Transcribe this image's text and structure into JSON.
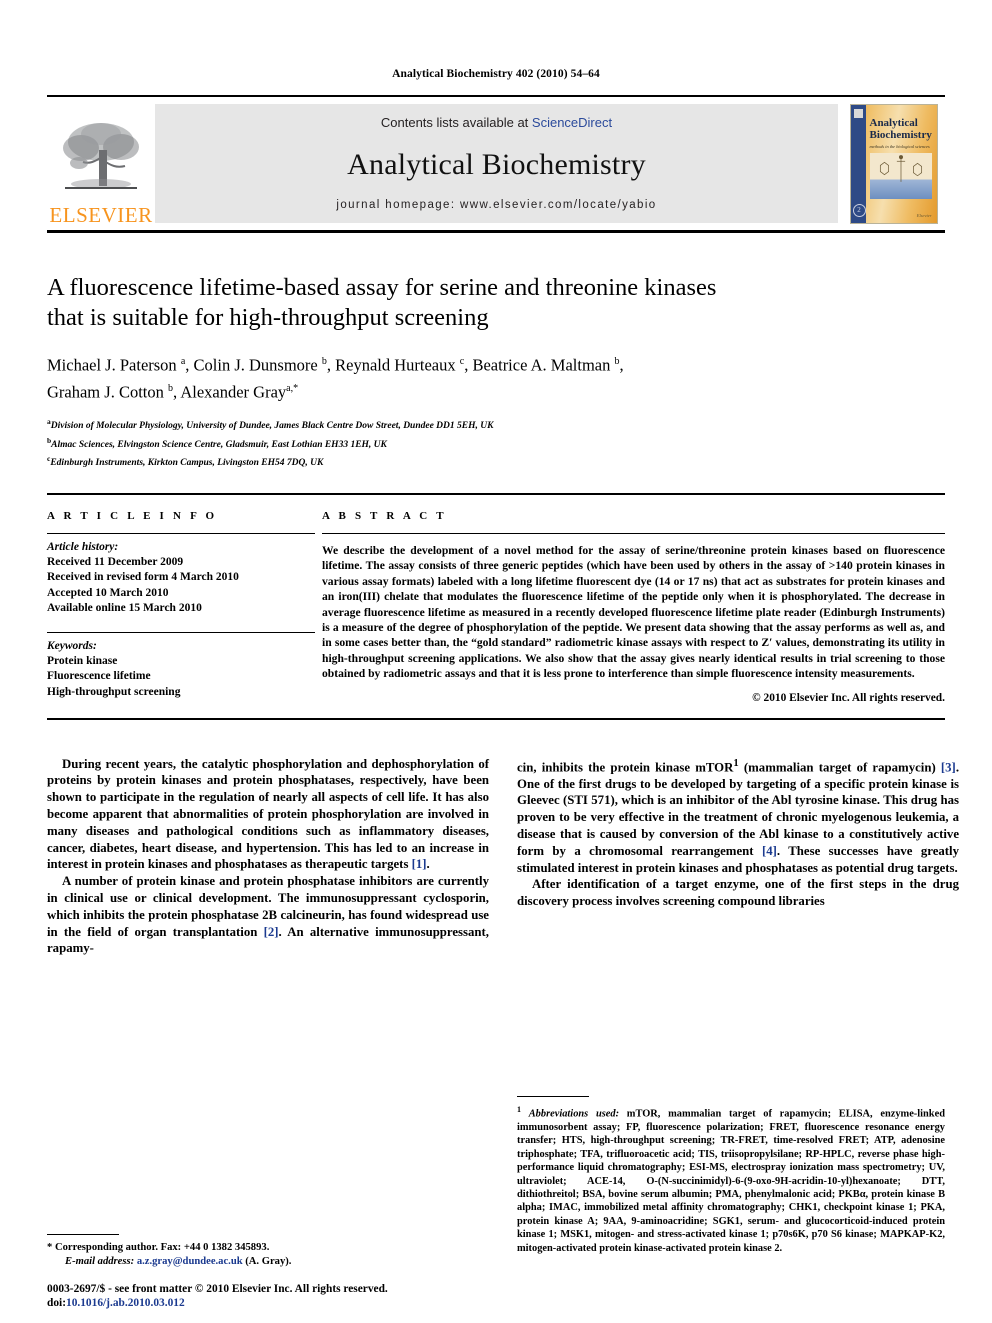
{
  "running_head": "Analytical Biochemistry 402 (2010) 54–64",
  "masthead": {
    "contents_prefix": "Contents lists available at ",
    "sciencedirect": "ScienceDirect",
    "journal_title": "Analytical Biochemistry",
    "homepage": "journal homepage: www.elsevier.com/locate/yabio",
    "publisher_wordmark": "ELSEVIER",
    "cover": {
      "title_line1": "Analytical",
      "title_line2": "Biochemistry",
      "subtitle": "methods in the biological sciences",
      "imprint": "Elsevier",
      "circle_glyph": "2",
      "colors": {
        "spine": "#2e4a86",
        "paper": "#f0c069",
        "accent": "#e49a2c"
      }
    },
    "colors": {
      "band_background": "#e6e6e6",
      "sciencedirect_link": "#2b4a9b",
      "elsevier_orange": "#F7941E"
    }
  },
  "article": {
    "title_line1": "A fluorescence lifetime-based assay for serine and threonine kinases",
    "title_line2": "that is suitable for high-throughput screening",
    "authors_line1": "Michael J. Paterson a, Colin J. Dunsmore b, Reynald Hurteaux c, Beatrice A. Maltman b,",
    "authors_line2": "Graham J. Cotton b, Alexander Gray a,*",
    "authors": [
      {
        "name": "Michael J. Paterson",
        "marks": "a"
      },
      {
        "name": "Colin J. Dunsmore",
        "marks": "b"
      },
      {
        "name": "Reynald Hurteaux",
        "marks": "c"
      },
      {
        "name": "Beatrice A. Maltman",
        "marks": "b"
      },
      {
        "name": "Graham J. Cotton",
        "marks": "b"
      },
      {
        "name": "Alexander Gray",
        "marks": "a,*"
      }
    ],
    "affiliations": [
      {
        "mark": "a",
        "text": "Division of Molecular Physiology, University of Dundee, James Black Centre Dow Street, Dundee DD1 5EH, UK"
      },
      {
        "mark": "b",
        "text": "Almac Sciences, Elvingston Science Centre, Gladsmuir, East Lothian EH33 1EH, UK"
      },
      {
        "mark": "c",
        "text": "Edinburgh Instruments, Kirkton Campus, Livingston EH54 7DQ, UK"
      }
    ]
  },
  "article_info": {
    "heading": "A R T I C L E  I N F O",
    "history_label": "Article history:",
    "history": [
      "Received 11 December 2009",
      "Received in revised form 4 March 2010",
      "Accepted 10 March 2010",
      "Available online 15 March 2010"
    ],
    "keywords_label": "Keywords:",
    "keywords": [
      "Protein kinase",
      "Fluorescence lifetime",
      "High-throughput screening"
    ]
  },
  "abstract": {
    "heading": "A B S T R A C T",
    "text": "We describe the development of a novel method for the assay of serine/threonine protein kinases based on fluorescence lifetime. The assay consists of three generic peptides (which have been used by others in the assay of >140 protein kinases in various assay formats) labeled with a long lifetime fluorescent dye (14 or 17 ns) that act as substrates for protein kinases and an iron(III) chelate that modulates the fluorescence lifetime of the peptide only when it is phosphorylated. The decrease in average fluorescence lifetime as measured in a recently developed fluorescence lifetime plate reader (Edinburgh Instruments) is a measure of the degree of phosphorylation of the peptide. We present data showing that the assay performs as well as, and in some cases better than, the “gold standard” radiometric kinase assays with respect to Z′ values, demonstrating its utility in high-throughput screening applications. We also show that the assay gives nearly identical results in trial screening to those obtained by radiometric assays and that it is less prone to interference than simple fluorescence intensity measurements.",
    "copyright": "© 2010 Elsevier Inc. All rights reserved."
  },
  "body": {
    "left_col": [
      "During recent years, the catalytic phosphorylation and dephosphorylation of proteins by protein kinases and protein phosphatases, respectively, have been shown to participate in the regulation of nearly all aspects of cell life. It has also become apparent that abnormalities of protein phosphorylation are involved in many diseases and pathological conditions such as inflammatory diseases, cancer, diabetes, heart disease, and hypertension. This has led to an increase in interest in protein kinases and phosphatases as therapeutic targets [1].",
      "A number of protein kinase and protein phosphatase inhibitors are currently in clinical use or clinical development. The immunosuppressant cyclosporin, which inhibits the protein phosphatase 2B calcineurin, has found widespread use in the field of organ transplantation [2]. An alternative immunosuppressant, rapamy-"
    ],
    "right_col": [
      "cin, inhibits the protein kinase mTOR1 (mammalian target of rapamycin) [3]. One of the first drugs to be developed by targeting of a specific protein kinase is Gleevec (STI 571), which is an inhibitor of the Abl tyrosine kinase. This drug has proven to be very effective in the treatment of chronic myelogenous leukemia, a disease that is caused by conversion of the Abl kinase to a constitutively active form by a chromosomal rearrangement [4]. These successes have greatly stimulated interest in protein kinases and phosphatases as potential drug targets.",
      "After identification of a target enzyme, one of the first steps in the drug discovery process involves screening compound libraries"
    ]
  },
  "footnotes": {
    "corresponding": "* Corresponding author. Fax: +44 0 1382 345893.",
    "email_label": "E-mail address:",
    "email": "a.z.gray@dundee.ac.uk",
    "email_suffix": " (A. Gray).",
    "abbrev_marker": "1",
    "abbrev_label": "Abbreviations used:",
    "abbrev_text": " mTOR, mammalian target of rapamycin; ELISA, enzyme-linked immunosorbent assay; FP, fluorescence polarization; FRET, fluorescence resonance energy transfer; HTS, high-throughput screening; TR-FRET, time-resolved FRET; ATP, adenosine triphosphate; TFA, trifluoroacetic acid; TIS, triisopropylsilane; RP-HPLC, reverse phase high-performance liquid chromatography; ESI-MS, electrospray ionization mass spectrometry; UV, ultraviolet; ACE-14, O-(N-succinimidyl)-6-(9-oxo-9H-acridin-10-yl)hexanoate; DTT, dithiothreitol; BSA, bovine serum albumin; PMA, phenylmalonic acid; PKBα, protein kinase B alpha; IMAC, immobilized metal affinity chromatography; CHK1, checkpoint kinase 1; PKA, protein kinase A; 9AA, 9-aminoacridine; SGK1, serum- and glucocorticoid-induced protein kinase 1; MSK1, mitogen- and stress-activated kinase 1; p70s6K, p70 S6 kinase; MAPKAP-K2, mitogen-activated protein kinase-activated protein kinase 2."
  },
  "issn_line": {
    "prefix": "0003-2697/$ - see front matter © 2010 Elsevier Inc. All rights reserved.",
    "doi_label": "doi:",
    "doi": "10.1016/j.ab.2010.03.012"
  }
}
